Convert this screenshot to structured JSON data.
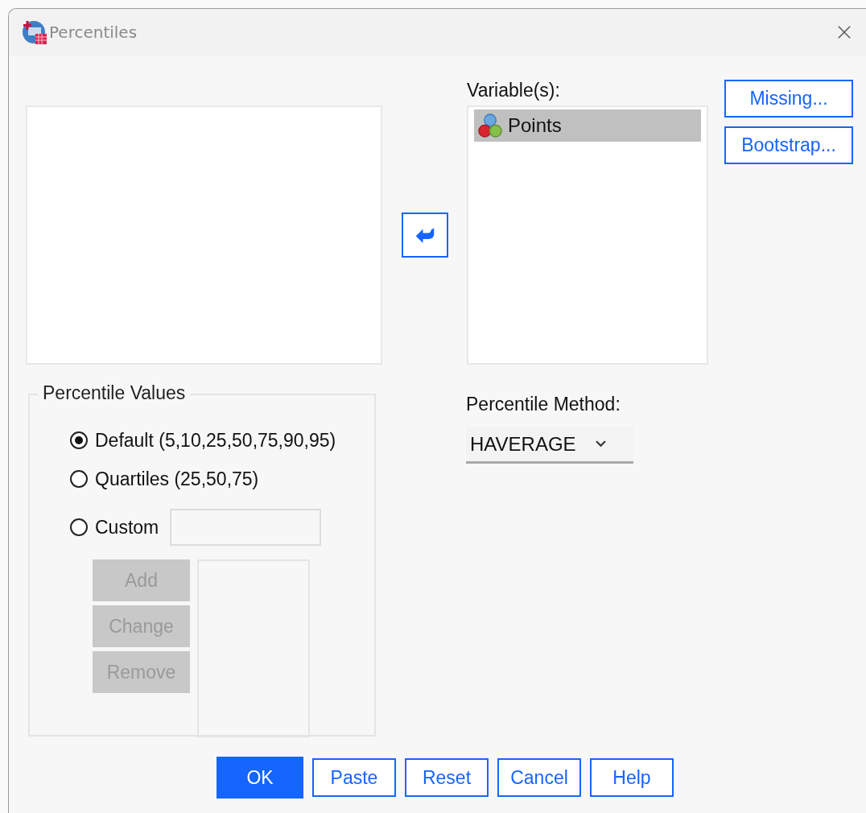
{
  "window": {
    "title": "Percentiles"
  },
  "variables": {
    "label": "Variable(s):",
    "items": [
      {
        "name": "Points",
        "selected": true
      }
    ]
  },
  "side_buttons": [
    {
      "label": "Missing..."
    },
    {
      "label": "Bootstrap..."
    }
  ],
  "percentile_values": {
    "title": "Percentile Values",
    "options": [
      {
        "kind": "radio",
        "label": "Default (5,10,25,50,75,90,95)",
        "selected": true
      },
      {
        "kind": "radio",
        "label": "Quartiles (25,50,75)",
        "selected": false
      },
      {
        "kind": "radio_field",
        "label": "Custom",
        "selected": false
      }
    ],
    "custom_buttons": [
      {
        "label": "Add",
        "disabled": true
      },
      {
        "label": "Change",
        "disabled": true
      },
      {
        "label": "Remove",
        "disabled": true
      }
    ]
  },
  "percentile_method": {
    "label": "Percentile Method:",
    "value": "HAVERAGE"
  },
  "buttons": [
    {
      "label": "OK",
      "default": true
    },
    {
      "label": "Paste",
      "default": false
    },
    {
      "label": "Reset",
      "default": false
    },
    {
      "label": "Cancel",
      "default": false
    },
    {
      "label": "Help",
      "default": false
    }
  ]
}
